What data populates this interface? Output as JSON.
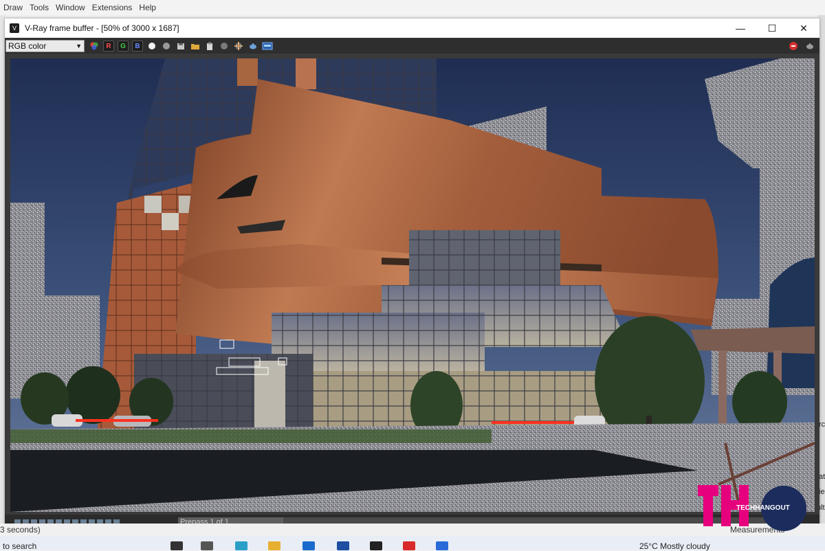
{
  "host_app": {
    "menu": [
      "Draw",
      "Tools",
      "Window",
      "Extensions",
      "Help"
    ],
    "status_text": "3 seconds)",
    "right_panel_labels": [
      "rc",
      "at",
      "ie",
      "ult"
    ],
    "measurements_label": "Measurements",
    "search_text": "to search"
  },
  "window": {
    "title": "V-Ray frame buffer - [50% of 3000 x 1687]",
    "minimize": "—",
    "maximize": "☐",
    "close": "✕"
  },
  "toolbar": {
    "channel_value": "RGB color",
    "r_label": "R",
    "g_label": "G",
    "b_label": "B"
  },
  "status": {
    "progress_text": "Prepass 1 of 1..."
  },
  "taskbar": {
    "weather": "25°C  Mostly cloudy"
  },
  "logo": {
    "letters": "TH",
    "brand": "TECHHANGOUT"
  },
  "colors": {
    "copper": "#b06a45",
    "sky": "#33466e",
    "brand_pink": "#e6007e",
    "brand_navy": "#1c2c5c"
  }
}
